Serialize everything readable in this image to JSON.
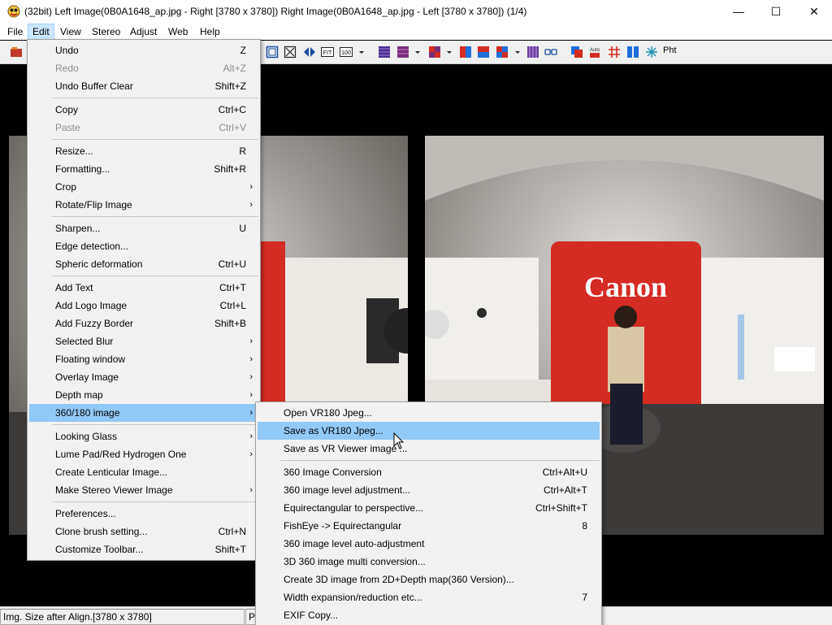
{
  "window": {
    "title": "(32bit) Left Image(0B0A1648_ap.jpg - Right [3780 x 3780]) Right Image(0B0A1648_ap.jpg - Left [3780 x 3780])  (1/4)",
    "minimize": "—",
    "maximize": "☐",
    "close": "✕"
  },
  "menubar": [
    "File",
    "Edit",
    "View",
    "Stereo",
    "Adjust",
    "Web",
    "Help"
  ],
  "edit_menu": [
    {
      "label": "Undo",
      "shortcut": "Z"
    },
    {
      "label": "Redo",
      "shortcut": "Alt+Z",
      "disabled": true
    },
    {
      "label": "Undo Buffer Clear",
      "shortcut": "Shift+Z"
    },
    {
      "sep": true
    },
    {
      "label": "Copy",
      "shortcut": "Ctrl+C"
    },
    {
      "label": "Paste",
      "shortcut": "Ctrl+V",
      "disabled": true
    },
    {
      "sep": true
    },
    {
      "label": "Resize...",
      "shortcut": "R"
    },
    {
      "label": "Formatting...",
      "shortcut": "Shift+R"
    },
    {
      "label": "Crop",
      "submenu": true
    },
    {
      "label": "Rotate/Flip Image",
      "submenu": true
    },
    {
      "sep": true
    },
    {
      "label": "Sharpen...",
      "shortcut": "U"
    },
    {
      "label": "Edge detection..."
    },
    {
      "label": "Spheric deformation",
      "shortcut": "Ctrl+U"
    },
    {
      "sep": true
    },
    {
      "label": "Add Text",
      "shortcut": "Ctrl+T"
    },
    {
      "label": "Add Logo Image",
      "shortcut": "Ctrl+L"
    },
    {
      "label": "Add Fuzzy Border",
      "shortcut": "Shift+B"
    },
    {
      "label": "Selected Blur",
      "submenu": true
    },
    {
      "label": "Floating window",
      "submenu": true
    },
    {
      "label": "Overlay Image",
      "submenu": true
    },
    {
      "label": "Depth map",
      "submenu": true
    },
    {
      "label": "360/180 image",
      "submenu": true,
      "highlight": true
    },
    {
      "sep": true
    },
    {
      "label": "Looking Glass",
      "submenu": true
    },
    {
      "label": "Lume Pad/Red Hydrogen One",
      "submenu": true
    },
    {
      "label": "Create Lenticular Image..."
    },
    {
      "label": "Make Stereo Viewer Image",
      "submenu": true
    },
    {
      "sep": true
    },
    {
      "label": "Preferences..."
    },
    {
      "label": "Clone brush setting...",
      "shortcut": "Ctrl+N"
    },
    {
      "label": "Customize Toolbar...",
      "shortcut": "Shift+T"
    }
  ],
  "submenu_360": [
    {
      "label": "Open VR180 Jpeg..."
    },
    {
      "label": "Save as VR180 Jpeg...",
      "highlight": true
    },
    {
      "label": "Save as VR Viewer image ..."
    },
    {
      "sep": true
    },
    {
      "label": "360 Image Conversion",
      "shortcut": "Ctrl+Alt+U"
    },
    {
      "label": "360 image level adjustment...",
      "shortcut": "Ctrl+Alt+T"
    },
    {
      "label": "Equirectangular to perspective...",
      "shortcut": "Ctrl+Shift+T"
    },
    {
      "label": "FishEye -> Equirectangular",
      "shortcut": "8"
    },
    {
      "label": "360 image level auto-adjustment"
    },
    {
      "label": "3D 360 image multi conversion..."
    },
    {
      "label": "Create 3D image from 2D+Depth map(360 Version)..."
    },
    {
      "label": "Width expansion/reduction etc...",
      "shortcut": "7"
    },
    {
      "label": "EXIF Copy..."
    }
  ],
  "toolbar": {
    "icons": [
      "open-icon",
      "frame-icon",
      "fit-window-icon",
      "align-left-right-icon",
      "fit-icon",
      "zoom-100-icon",
      "dropdown-icon",
      "stripe-purple-icon",
      "stripe-magenta-icon",
      "dropdown-icon",
      "checker-icon",
      "dropdown-icon",
      "red-blue-icon",
      "red-blue-2-icon",
      "quad-icon",
      "dropdown-icon",
      "vertical-stripes-icon",
      "glasses-icon",
      "overlay-icon",
      "auto-icon",
      "grid-icon",
      "side-by-side-icon",
      "snowflake-icon",
      "pht-icon"
    ],
    "fit_label": "FIT",
    "zoom_label": "100",
    "auto_label": "Auto",
    "pht_label": "Pht"
  },
  "status": {
    "cell1": "Img. Size after Align.[3780 x 3780]",
    "cell2": "Pe"
  },
  "sign_text": "Canon",
  "colors": {
    "highlight": "#91c9f7",
    "menu_bg": "#f2f2f2",
    "accent_red": "#d42b23"
  }
}
